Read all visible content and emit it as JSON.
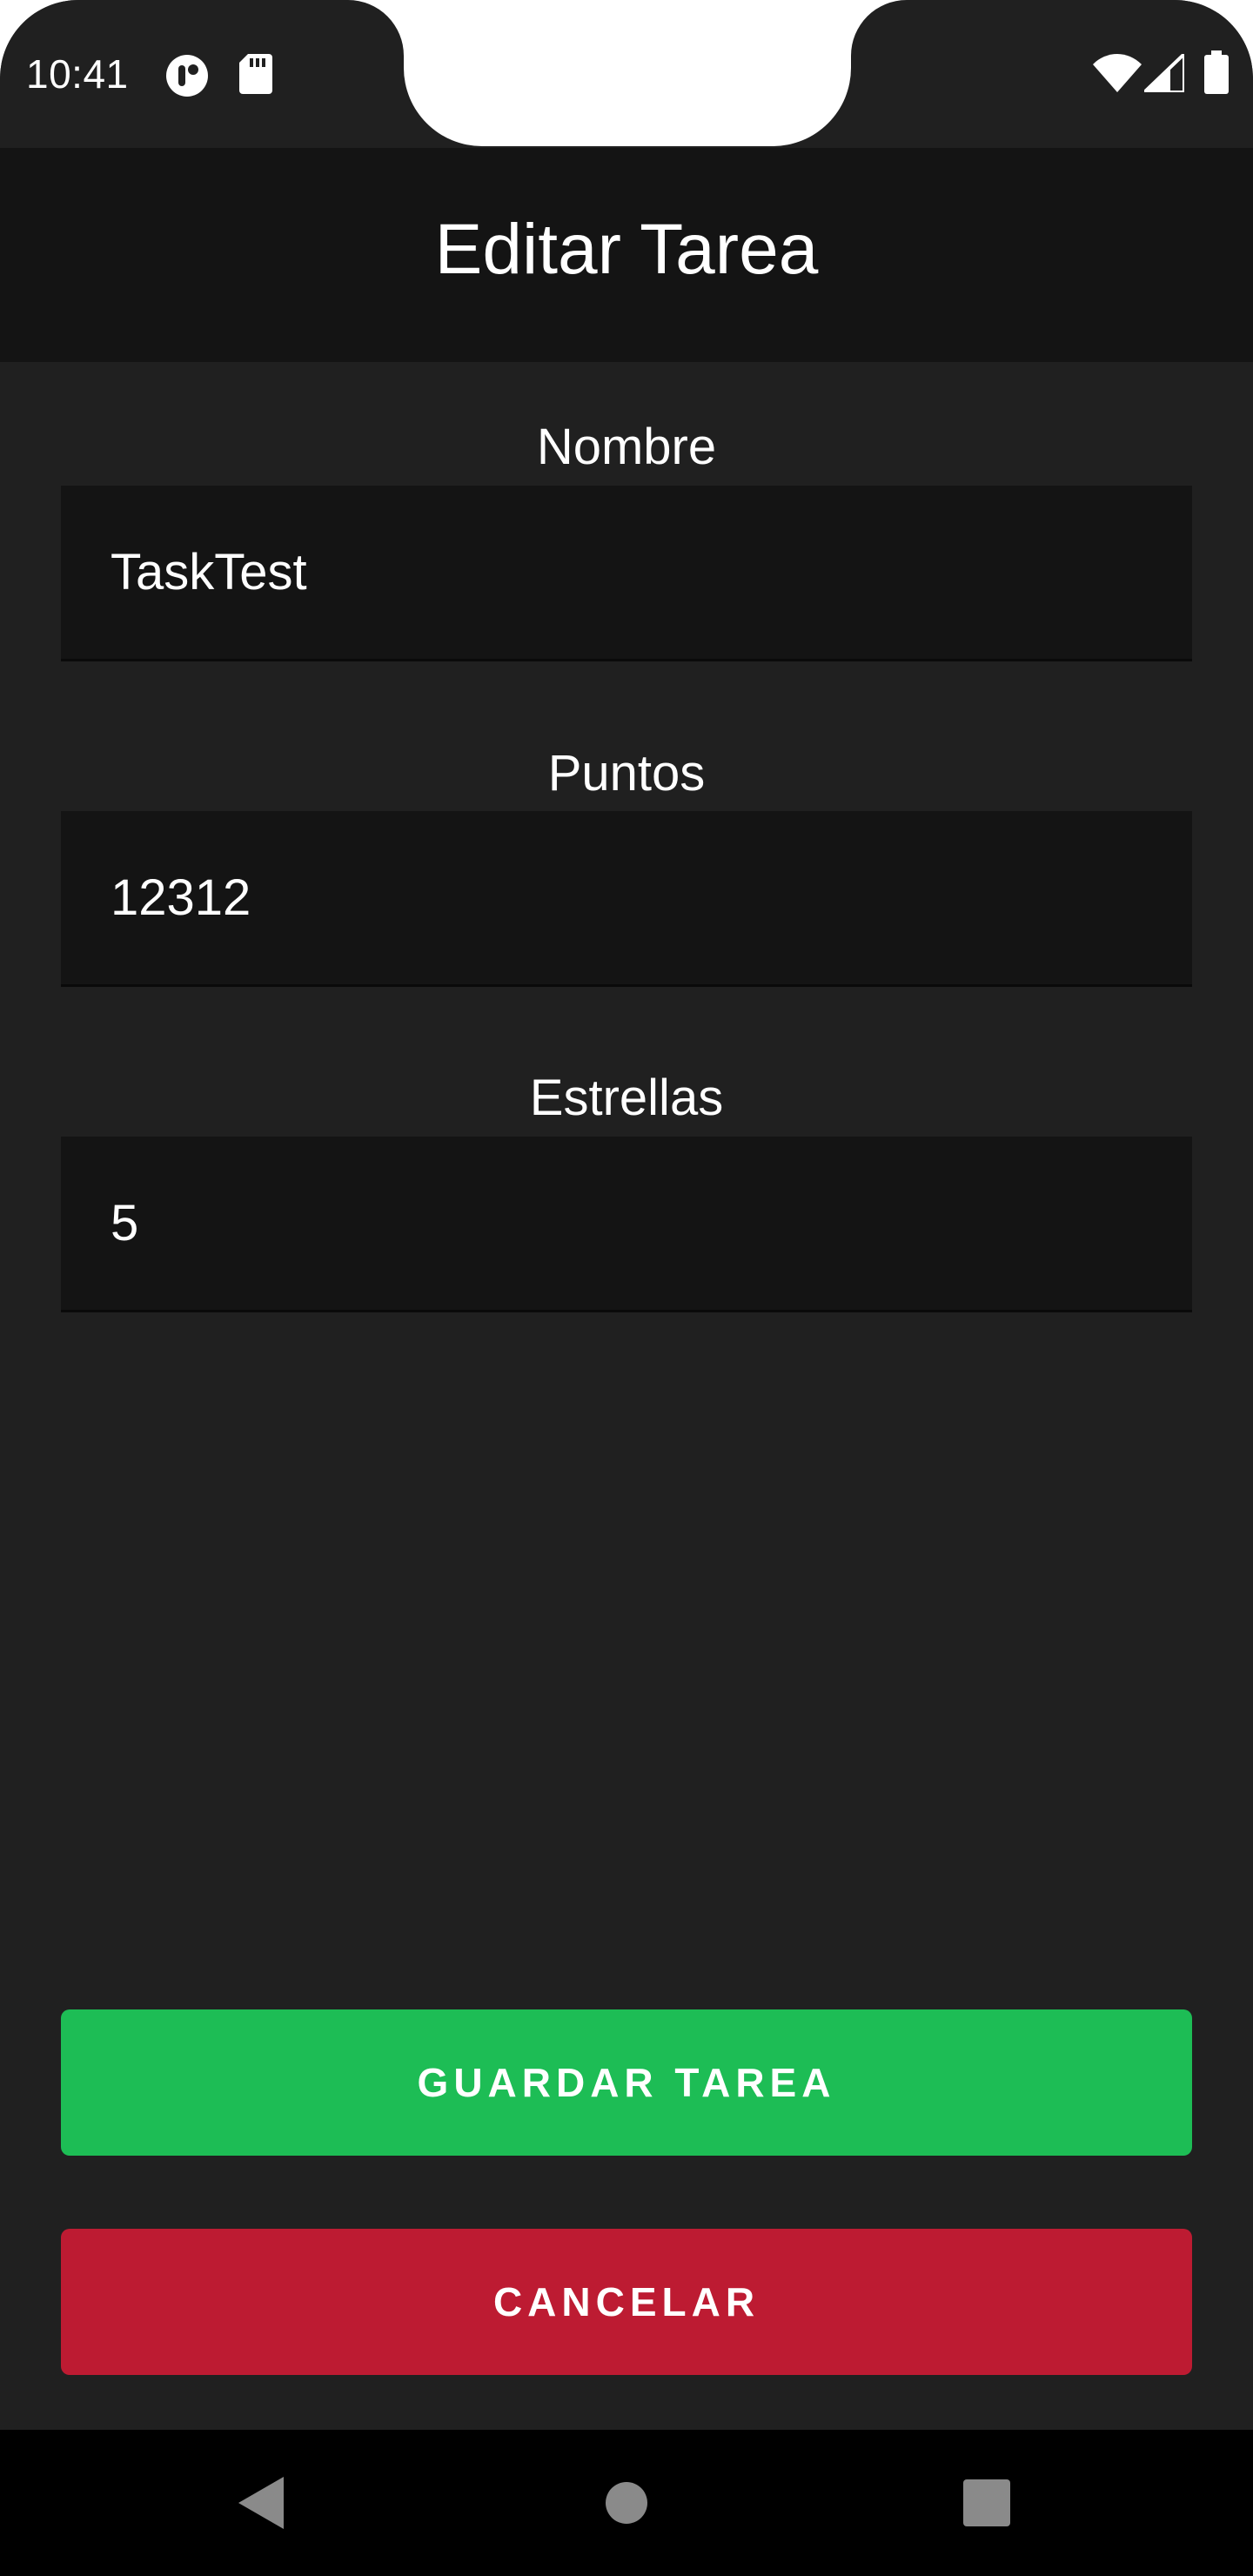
{
  "status_bar": {
    "time": "10:41",
    "icons": [
      "sync-icon",
      "sd-card-icon",
      "wifi-icon",
      "signal-icon",
      "battery-icon"
    ]
  },
  "app_bar": {
    "title": "Editar Tarea"
  },
  "form": {
    "name": {
      "label": "Nombre",
      "value": "TaskTest"
    },
    "points": {
      "label": "Puntos",
      "value": "12312"
    },
    "stars": {
      "label": "Estrellas",
      "value": "5"
    }
  },
  "actions": {
    "save_label": "GUARDAR TAREA",
    "cancel_label": "CANCELAR"
  },
  "colors": {
    "background": "#202020",
    "app_bar": "#141414",
    "field": "#141414",
    "save": "#1dbd55",
    "cancel": "#bd1b32",
    "nav_bar": "#000000"
  },
  "nav_bar": {
    "icons": [
      "back-icon",
      "home-icon",
      "recents-icon"
    ]
  }
}
